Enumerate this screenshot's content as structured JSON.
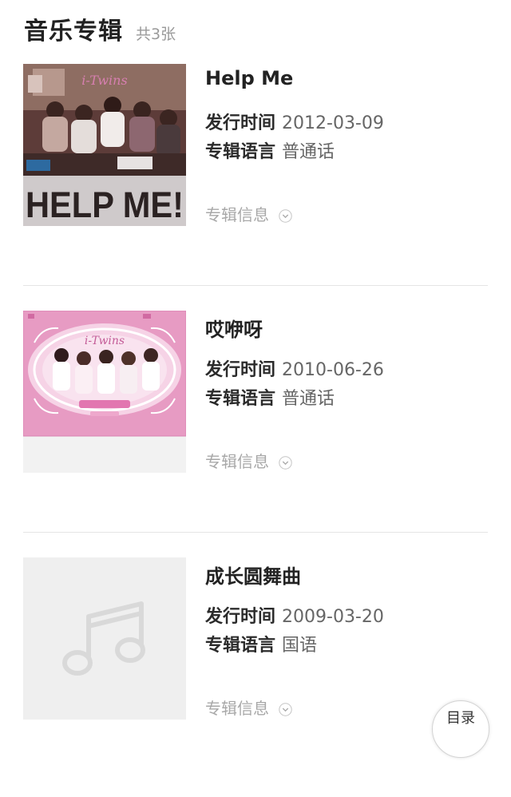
{
  "header": {
    "title": "音乐专辑",
    "count": "共3张"
  },
  "albums": [
    {
      "title": "Help Me",
      "release_label": "发行时间",
      "release_date": "2012-03-09",
      "language_label": "专辑语言",
      "language": "普通话",
      "info_label": "专辑信息",
      "cover_text": "HELP ME!",
      "cover_logo": "i-Twins"
    },
    {
      "title": "哎咿呀",
      "release_label": "发行时间",
      "release_date": "2010-06-26",
      "language_label": "专辑语言",
      "language": "普通话",
      "info_label": "专辑信息",
      "cover_logo": "i-Twins"
    },
    {
      "title": "成长圆舞曲",
      "release_label": "发行时间",
      "release_date": "2009-03-20",
      "language_label": "专辑语言",
      "language": "国语",
      "info_label": "专辑信息"
    }
  ],
  "fab": {
    "label": "目录"
  },
  "colors": {
    "title": "#222222",
    "muted": "#9a9a9a",
    "divider": "#e5e5e5",
    "cover_pink": "#e79bc3",
    "placeholder_bg": "#efefef",
    "placeholder_icon": "#d9d9d9"
  }
}
